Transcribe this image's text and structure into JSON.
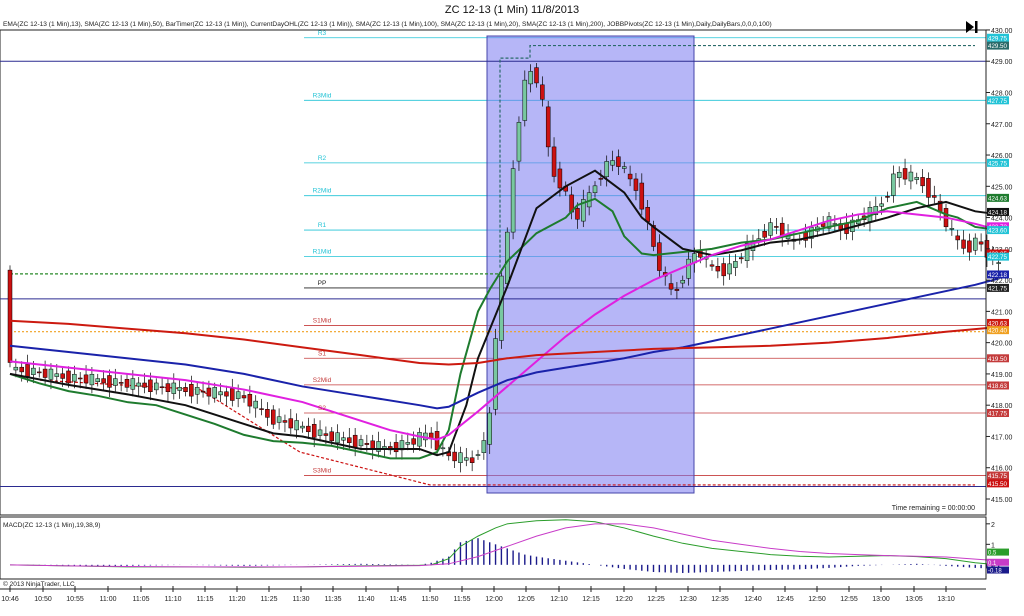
{
  "window": {
    "title": "ZC 12-13 (1 Min)  11/8/2013"
  },
  "indicator_caption": "EMA(ZC 12-13 (1 Min),13), SMA(ZC 12-13 (1 Min),50), BarTimer(ZC 12-13 (1 Min)), CurrentDayOHL(ZC 12-13 (1 Min)), SMA(ZC 12-13 (1 Min),100), SMA(ZC 12-13 (1 Min),20), SMA(ZC 12-13 (1 Min),200), JOBBPivots(ZC 12-13 (1 Min),Daily,DailyBars,0,0,0,100)",
  "timer_text": "Time remaining = 00:00:00",
  "macd_caption": "MACD(ZC 12-13 (1 Min),19,38,9)",
  "copyright": "© 2013 NinjaTrader, LLC",
  "icons": {
    "go_end": "skip-to-end-icon"
  },
  "colors": {
    "up_candle": "#78c8a0",
    "down_candle": "#cc1111",
    "ema13": "#1e7b2e",
    "sma20": "#111111",
    "sma50": "#e020e0",
    "sma100": "#1a22aa",
    "sma200": "#cc1a10",
    "pivot_resistance": "#22c3d6",
    "pivot_support": "#c43b3b",
    "highlight": "#7a7af0",
    "macd": "#2b9d2b",
    "macd_avg": "#c83cc8",
    "macd_hist": "#1a1a8a"
  },
  "chart_data": [
    {
      "type": "candlestick",
      "title": "ZC 12-13 (1 Min)  11/8/2013",
      "xlabel": "",
      "ylabel": "",
      "x_ticks": [
        "10:46",
        "10:50",
        "10:55",
        "11:00",
        "11:05",
        "11:10",
        "11:15",
        "11:20",
        "11:25",
        "11:30",
        "11:35",
        "11:40",
        "11:45",
        "11:50",
        "11:55",
        "12:00",
        "12:05",
        "12:10",
        "12:15",
        "12:20",
        "12:25",
        "12:30",
        "12:35",
        "12:40",
        "12:45",
        "12:50",
        "12:55",
        "13:00",
        "13:05",
        "13:10"
      ],
      "y_ticks": [
        "415.00",
        "416.00",
        "417.00",
        "418.00",
        "419.00",
        "420.00",
        "421.00",
        "422.00",
        "423.00",
        "424.00",
        "425.00",
        "426.00",
        "427.00",
        "428.00",
        "429.00",
        "430.00"
      ],
      "ylim": [
        414.9,
        430.1
      ],
      "pivots": [
        {
          "label": "R3",
          "value": 429.75,
          "kind": "r"
        },
        {
          "label": "R3Mid",
          "value": 427.75,
          "kind": "r"
        },
        {
          "label": "R2",
          "value": 425.75,
          "kind": "r"
        },
        {
          "label": "R2Mid",
          "value": 424.7,
          "kind": "r"
        },
        {
          "label": "R1",
          "value": 423.6,
          "kind": "r"
        },
        {
          "label": "R1Mid",
          "value": 422.75,
          "kind": "r"
        },
        {
          "label": "PP",
          "value": 421.75,
          "kind": "p"
        },
        {
          "label": "S1Mid",
          "value": 420.55,
          "kind": "s"
        },
        {
          "label": "S1",
          "value": 419.5,
          "kind": "s"
        },
        {
          "label": "S2Mid",
          "value": 418.65,
          "kind": "s"
        },
        {
          "label": "S2",
          "value": 417.75,
          "kind": "s"
        },
        {
          "label": "S3Mid",
          "value": 415.75,
          "kind": "s"
        }
      ],
      "price_badges": [
        "429.75",
        "429.50",
        "427.75",
        "425.75",
        "424.63",
        "424.18",
        "423.72",
        "423.60",
        "422.85",
        "422.75",
        "422.18",
        "421.75",
        "420.63",
        "420.40",
        "419.50",
        "418.63",
        "417.75",
        "415.75",
        "415.50"
      ],
      "series": [
        {
          "name": "EMA(ZC 12-13 (1 Min),13)",
          "color": "#1e7b2e",
          "x": [
            0,
            5,
            10,
            15,
            20,
            25,
            30,
            35,
            40,
            45,
            50,
            55,
            60,
            65,
            70,
            73,
            75,
            77,
            80,
            82,
            85,
            90,
            95,
            97,
            100,
            103,
            105,
            108,
            110,
            115,
            120,
            125,
            130,
            135,
            140,
            145,
            150,
            155,
            160,
            162,
            165,
            169
          ],
          "y": [
            419.0,
            418.7,
            418.45,
            418.3,
            418.1,
            418.0,
            417.7,
            417.4,
            417.05,
            416.85,
            416.8,
            416.7,
            416.5,
            416.3,
            416.3,
            416.5,
            417.2,
            419.0,
            421.0,
            421.7,
            422.6,
            423.5,
            424.0,
            424.4,
            424.6,
            424.2,
            423.4,
            422.85,
            422.8,
            422.9,
            423.0,
            423.2,
            423.3,
            423.5,
            423.7,
            423.9,
            424.3,
            424.5,
            424.1,
            424.0,
            423.7,
            423.6
          ]
        },
        {
          "name": "SMA(ZC 12-13 (1 Min),20)",
          "color": "#111111",
          "x": [
            0,
            10,
            20,
            30,
            40,
            45,
            50,
            55,
            60,
            65,
            70,
            73,
            75,
            78,
            80,
            85,
            90,
            95,
            100,
            105,
            108,
            110,
            115,
            120,
            125,
            130,
            135,
            140,
            145,
            150,
            155,
            160,
            165,
            169
          ],
          "y": [
            419.0,
            418.65,
            418.35,
            418.0,
            417.4,
            417.1,
            417.0,
            416.8,
            416.6,
            416.6,
            416.6,
            416.4,
            416.5,
            418.0,
            419.5,
            421.8,
            424.3,
            425.0,
            425.5,
            424.8,
            424.0,
            423.7,
            423.0,
            422.8,
            422.95,
            423.2,
            423.3,
            423.5,
            423.75,
            424.0,
            424.3,
            424.5,
            424.2,
            424.1
          ]
        },
        {
          "name": "SMA(ZC 12-13 (1 Min),50)",
          "color": "#e020e0",
          "x": [
            0,
            10,
            20,
            30,
            40,
            50,
            55,
            60,
            65,
            70,
            73,
            75,
            80,
            85,
            90,
            95,
            100,
            105,
            110,
            115,
            120,
            125,
            130,
            135,
            140,
            145,
            150,
            160,
            165,
            169
          ],
          "y": [
            419.4,
            419.2,
            419.0,
            418.8,
            418.5,
            418.1,
            417.8,
            417.5,
            417.2,
            417.0,
            416.9,
            417.05,
            417.8,
            418.6,
            419.4,
            420.2,
            420.9,
            421.5,
            422.0,
            422.4,
            422.8,
            423.1,
            423.3,
            423.6,
            423.9,
            424.1,
            424.2,
            424.0,
            423.8,
            423.6
          ]
        },
        {
          "name": "SMA(ZC 12-13 (1 Min),100)",
          "color": "#1a22aa",
          "x": [
            0,
            10,
            20,
            30,
            40,
            50,
            60,
            70,
            73,
            75,
            80,
            85,
            90,
            95,
            100,
            105,
            110,
            115,
            120,
            125,
            130,
            135,
            140,
            145,
            150,
            155,
            160,
            165,
            169
          ],
          "y": [
            419.9,
            419.7,
            419.5,
            419.3,
            419.0,
            418.6,
            418.3,
            418.0,
            417.9,
            417.95,
            418.4,
            418.8,
            419.05,
            419.2,
            419.35,
            419.5,
            419.7,
            419.85,
            420.05,
            420.25,
            420.45,
            420.65,
            420.85,
            421.05,
            421.25,
            421.45,
            421.65,
            421.85,
            422.05
          ]
        },
        {
          "name": "SMA(ZC 12-13 (1 Min),200)",
          "color": "#cc1a10",
          "x": [
            0,
            10,
            20,
            30,
            40,
            50,
            60,
            70,
            75,
            80,
            85,
            90,
            100,
            110,
            120,
            130,
            140,
            150,
            160,
            169
          ],
          "y": [
            420.7,
            420.6,
            420.45,
            420.3,
            420.1,
            419.85,
            419.6,
            419.35,
            419.3,
            419.35,
            419.5,
            419.6,
            419.7,
            419.8,
            419.85,
            419.9,
            420.0,
            420.15,
            420.35,
            420.5
          ]
        }
      ],
      "note": "x of moving-average series is the bar index; 170 one-minute bars from 10:46 to 13:14"
    },
    {
      "type": "line",
      "title": "MACD(ZC 12-13 (1 Min),19,38,9)",
      "y_ticks": [
        "0",
        "1",
        "2"
      ],
      "ylim": [
        -0.35,
        2.25
      ],
      "price_badges": [
        "0.5",
        "0.1",
        "-0.18"
      ],
      "series": [
        {
          "name": "MACD",
          "color": "#2b9d2b",
          "x": [
            0,
            10,
            20,
            30,
            40,
            50,
            60,
            70,
            72,
            75,
            77,
            80,
            83,
            85,
            90,
            95,
            100,
            105,
            110,
            115,
            120,
            125,
            130,
            135,
            140,
            145,
            150,
            155,
            160,
            165,
            169
          ],
          "y": [
            0.0,
            -0.05,
            -0.1,
            -0.1,
            -0.12,
            -0.1,
            -0.05,
            -0.02,
            0.0,
            0.3,
            0.9,
            1.4,
            1.8,
            2.0,
            2.15,
            2.2,
            2.1,
            1.8,
            1.4,
            1.05,
            0.8,
            0.65,
            0.5,
            0.42,
            0.38,
            0.42,
            0.45,
            0.4,
            0.3,
            0.1,
            0.0
          ]
        },
        {
          "name": "Avg",
          "color": "#c83cc8",
          "x": [
            0,
            10,
            20,
            30,
            40,
            50,
            60,
            70,
            75,
            80,
            85,
            90,
            95,
            100,
            105,
            110,
            115,
            120,
            125,
            130,
            135,
            140,
            145,
            150,
            155,
            160,
            165,
            169
          ],
          "y": [
            0.0,
            -0.05,
            -0.08,
            -0.1,
            -0.1,
            -0.1,
            -0.07,
            -0.04,
            0.05,
            0.4,
            0.9,
            1.4,
            1.8,
            2.0,
            2.0,
            1.8,
            1.5,
            1.2,
            1.0,
            0.8,
            0.65,
            0.55,
            0.5,
            0.45,
            0.42,
            0.38,
            0.28,
            0.2
          ]
        },
        {
          "name": "Diff",
          "color": "#1a1a8a",
          "x": [
            0,
            10,
            20,
            30,
            40,
            50,
            60,
            70,
            72,
            75,
            77,
            80,
            83,
            85,
            88,
            90,
            95,
            100,
            105,
            110,
            115,
            120,
            125,
            130,
            135,
            140,
            145,
            150,
            155,
            160,
            165,
            169
          ],
          "y": [
            0.0,
            -0.05,
            -0.05,
            0.0,
            -0.05,
            0.0,
            0.05,
            0.0,
            0.1,
            0.4,
            1.1,
            1.3,
            1.0,
            0.8,
            0.5,
            0.4,
            0.2,
            0.0,
            -0.2,
            -0.35,
            -0.4,
            -0.35,
            -0.3,
            -0.25,
            -0.22,
            -0.15,
            -0.05,
            0.0,
            0.05,
            -0.05,
            -0.15,
            -0.2
          ]
        }
      ]
    }
  ]
}
